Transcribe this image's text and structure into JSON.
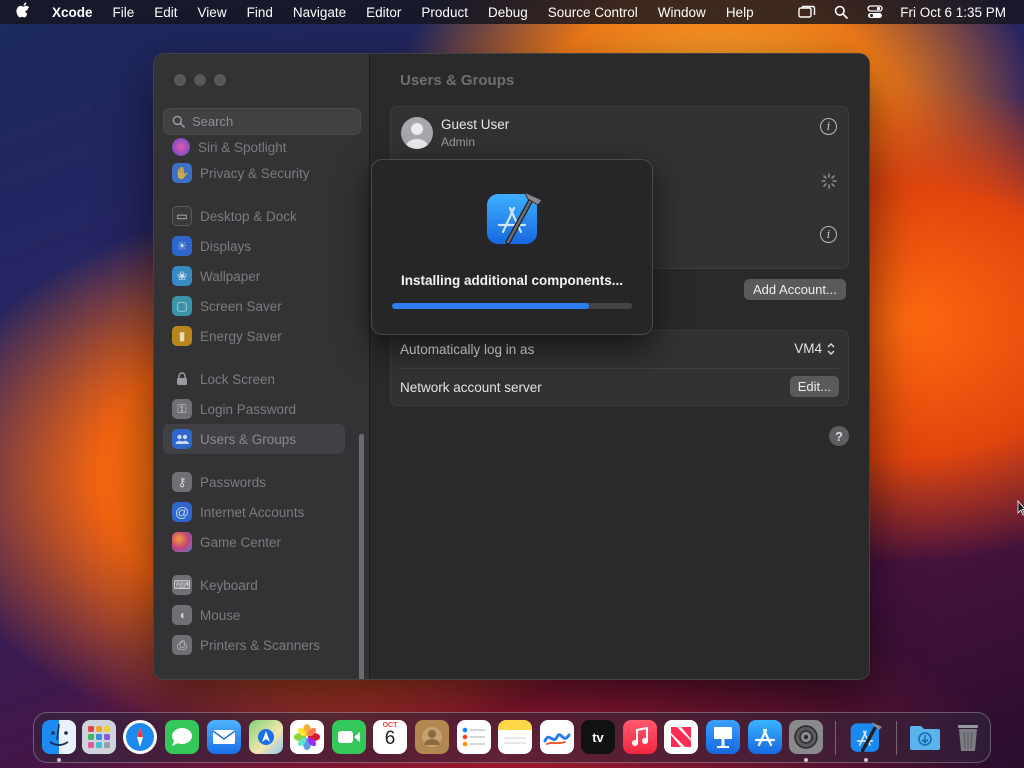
{
  "menubar": {
    "app_name": "Xcode",
    "menus": [
      "File",
      "Edit",
      "View",
      "Find",
      "Navigate",
      "Editor",
      "Product",
      "Debug",
      "Source Control",
      "Window",
      "Help"
    ],
    "clock": "Fri Oct 6  1:35 PM"
  },
  "sidebar": {
    "search_placeholder": "Search",
    "items": [
      {
        "label": "Siri & Spotlight",
        "icon": "siri-icon",
        "color": "#6a4aa8"
      },
      {
        "label": "Privacy & Security",
        "icon": "hand-icon",
        "color": "#3d6fc4"
      },
      {
        "label": "Desktop & Dock",
        "icon": "dock-icon",
        "color": "#3a3a3c"
      },
      {
        "label": "Displays",
        "icon": "sun-icon",
        "color": "#2f66c9"
      },
      {
        "label": "Wallpaper",
        "icon": "flower-icon",
        "color": "#3a8ac2"
      },
      {
        "label": "Screen Saver",
        "icon": "screen-saver-icon",
        "color": "#3a93a6"
      },
      {
        "label": "Energy Saver",
        "icon": "battery-icon",
        "color": "#b8861c"
      },
      {
        "label": "Lock Screen",
        "icon": "lock-icon",
        "color": "#3a3a3c"
      },
      {
        "label": "Login Password",
        "icon": "key-icon",
        "color": "#707074"
      },
      {
        "label": "Users & Groups",
        "icon": "users-icon",
        "color": "#2f66c9"
      },
      {
        "label": "Passwords",
        "icon": "key-icon",
        "color": "#707074"
      },
      {
        "label": "Internet Accounts",
        "icon": "at-icon",
        "color": "#2f66c9"
      },
      {
        "label": "Game Center",
        "icon": "game-center-icon",
        "color": "#c0437a"
      },
      {
        "label": "Keyboard",
        "icon": "keyboard-icon",
        "color": "#707074"
      },
      {
        "label": "Mouse",
        "icon": "mouse-icon",
        "color": "#707074"
      },
      {
        "label": "Printers & Scanners",
        "icon": "printer-icon",
        "color": "#707074"
      }
    ]
  },
  "main": {
    "title": "Users & Groups",
    "users": [
      {
        "name": "Guest User",
        "role": "Admin"
      }
    ],
    "add_account": "Add Account...",
    "auto_login_label": "Automatically log in as",
    "auto_login_value": "VM4",
    "network_server_label": "Network account server",
    "edit_button": "Edit...",
    "help": "?"
  },
  "installer": {
    "message": "Installing additional components...",
    "progress": 0.82
  },
  "dock": {
    "calendar_month": "OCT",
    "calendar_day": "6",
    "tv_label": "tv",
    "apps": [
      "finder-icon",
      "launchpad-icon",
      "safari-icon",
      "messages-icon",
      "mail-icon",
      "maps-icon",
      "photos-icon",
      "facetime-icon",
      "calendar-icon",
      "contacts-icon",
      "reminders-icon",
      "notes-icon",
      "freeform-icon",
      "apple-tv-icon",
      "music-icon",
      "news-icon",
      "keynote-icon",
      "app-store-icon",
      "system-settings-icon",
      "xcode-icon",
      "downloads-icon",
      "trash-icon"
    ]
  }
}
